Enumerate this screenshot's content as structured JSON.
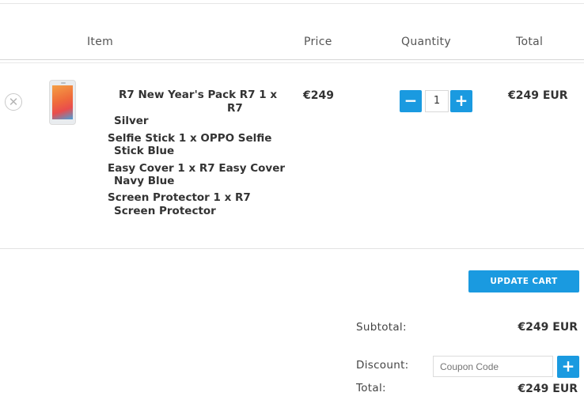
{
  "table": {
    "headers": {
      "item": "Item",
      "price": "Price",
      "quantity": "Quantity",
      "total": "Total"
    }
  },
  "cart_item": {
    "remove_symbol": "✕",
    "product_image_icon": "phone-image",
    "name_lines": [
      "R7 New Year's Pack R7 1 x",
      "R7",
      "Silver",
      "Selfie Stick 1 x OPPO Selfie",
      "Stick Blue",
      "Easy Cover 1 x R7 Easy Cover",
      "Navy Blue",
      "Screen Protector 1 x R7",
      "Screen Protector"
    ],
    "price": "€249",
    "quantity": "1",
    "minus_symbol": "−",
    "plus_symbol": "+",
    "total": "€249 EUR"
  },
  "actions": {
    "update_cart": "UPDATE CART"
  },
  "summary": {
    "subtotal_label": "Subtotal:",
    "subtotal_value": "€249 EUR",
    "discount_label": "Discount:",
    "coupon_placeholder": "Coupon Code",
    "coupon_button": "+",
    "total_label": "Total:",
    "total_value": "€249 EUR"
  },
  "colors": {
    "accent": "#1a9ae0"
  }
}
